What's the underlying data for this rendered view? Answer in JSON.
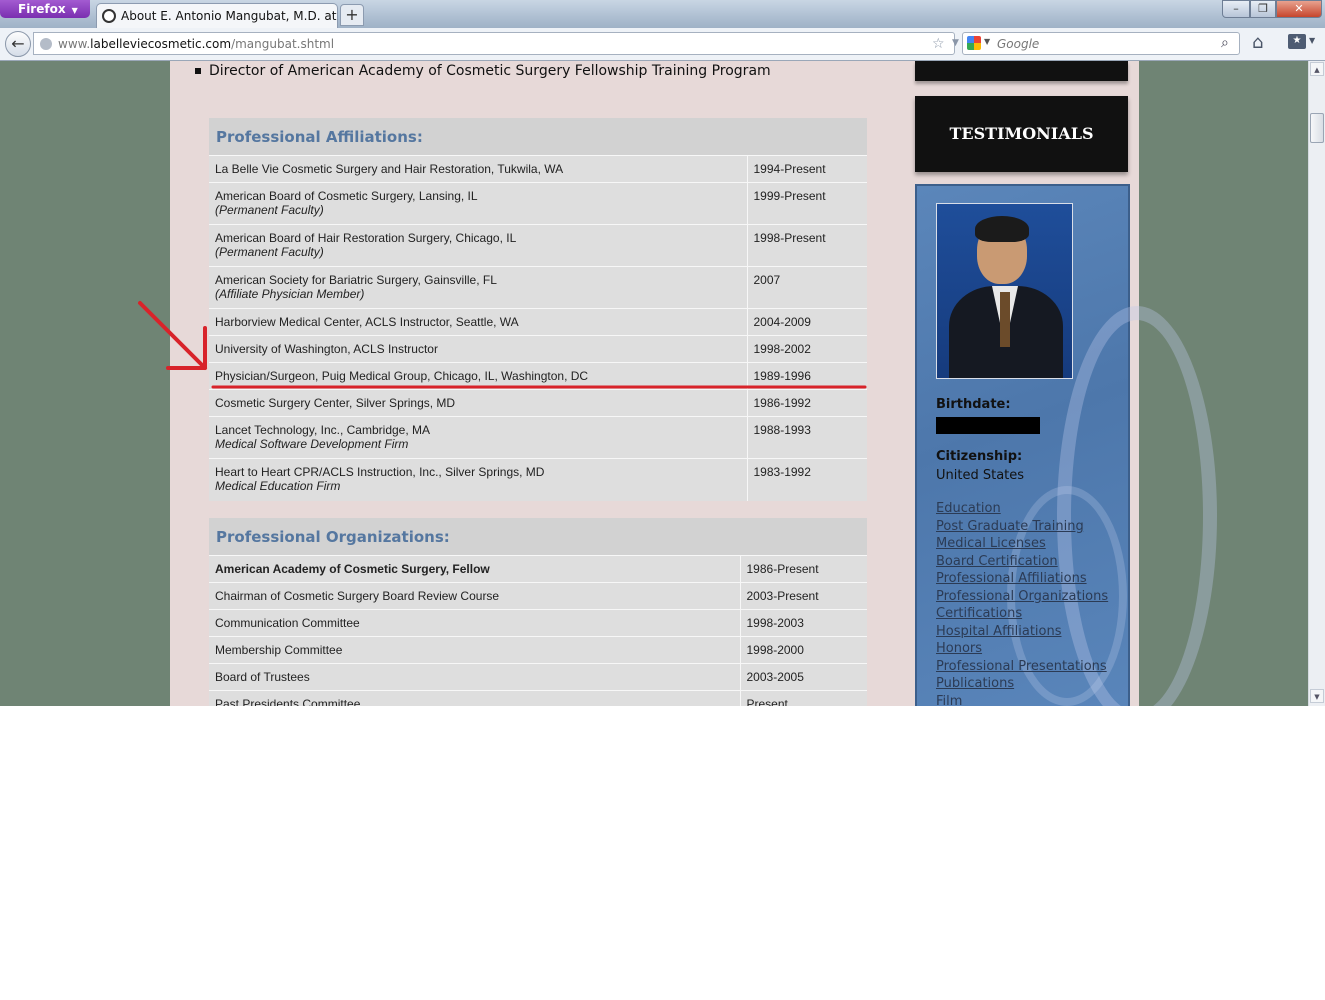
{
  "browser": {
    "menu_button": "Firefox",
    "tab_title": "About E. Antonio Mangubat, M.D. at La ...",
    "new_tab": "+",
    "url_prefix": "www.",
    "url_host": "labelleviecosmetic.com",
    "url_path": "/mangubat.shtml",
    "search_placeholder": "Google",
    "window_buttons": [
      "–",
      "❐",
      "✕"
    ]
  },
  "page": {
    "intro_bullet": "Director of American Academy of Cosmetic Surgery Fellowship Training Program",
    "affiliations": {
      "heading": "Professional Affiliations:",
      "rows": [
        {
          "name": "La Belle Vie Cosmetic Surgery and Hair Restoration, Tukwila, WA",
          "note": "",
          "years": "1994-Present"
        },
        {
          "name": "American Board of Cosmetic Surgery, Lansing, IL",
          "note": "(Permanent Faculty)",
          "years": "1999-Present"
        },
        {
          "name": "American Board of Hair Restoration Surgery, Chicago, IL",
          "note": "(Permanent Faculty)",
          "years": "1998-Present"
        },
        {
          "name": "American Society for Bariatric Surgery, Gainsville, FL",
          "note": "(Affiliate Physician Member)",
          "years": "2007"
        },
        {
          "name": "Harborview Medical Center, ACLS Instructor, Seattle, WA",
          "note": "",
          "years": "2004-2009"
        },
        {
          "name": "University of Washington, ACLS Instructor",
          "note": "",
          "years": "1998-2002"
        },
        {
          "name": "Physician/Surgeon, Puig Medical Group, Chicago, IL, Washington, DC",
          "note": "",
          "years": "1989-1996"
        },
        {
          "name": "Cosmetic Surgery Center, Silver Springs, MD",
          "note": "",
          "years": "1986-1992"
        },
        {
          "name": "Lancet Technology, Inc., Cambridge, MA",
          "note": "Medical Software Development Firm",
          "years": "1988-1993"
        },
        {
          "name": "Heart to Heart CPR/ACLS Instruction, Inc., Silver Springs, MD",
          "note": "Medical Education Firm",
          "years": "1983-1992"
        }
      ]
    },
    "organizations": {
      "heading": "Professional Organizations:",
      "rows": [
        {
          "name": "American Academy of Cosmetic Surgery, Fellow",
          "years": "1986-Present"
        },
        {
          "name": "Chairman of Cosmetic Surgery Board Review Course",
          "years": "2003-Present"
        },
        {
          "name": "Communication Committee",
          "years": "1998-2003"
        },
        {
          "name": "Membership Committee",
          "years": "1998-2000"
        },
        {
          "name": "Board of Trustees",
          "years": "2003-2005"
        },
        {
          "name": "Past Presidents Committee",
          "years": "Present"
        }
      ]
    },
    "sidebar": {
      "testimonials": "TESTIMONIALS",
      "birthdate_label": "Birthdate:",
      "citizenship_label": "Citizenship:",
      "citizenship_value": "United States",
      "links": [
        "Education",
        "Post Graduate Training",
        "Medical Licenses",
        "Board Certification",
        "Professional Affiliations",
        "Professional Organizations",
        "Certifications",
        "Hospital Affiliations",
        "Honors",
        "Professional Presentations",
        "Publications",
        "Film"
      ]
    }
  },
  "colors": {
    "annotation": "#d8232a",
    "heading_text": "#5577a0",
    "page_background": "#6f8474"
  }
}
